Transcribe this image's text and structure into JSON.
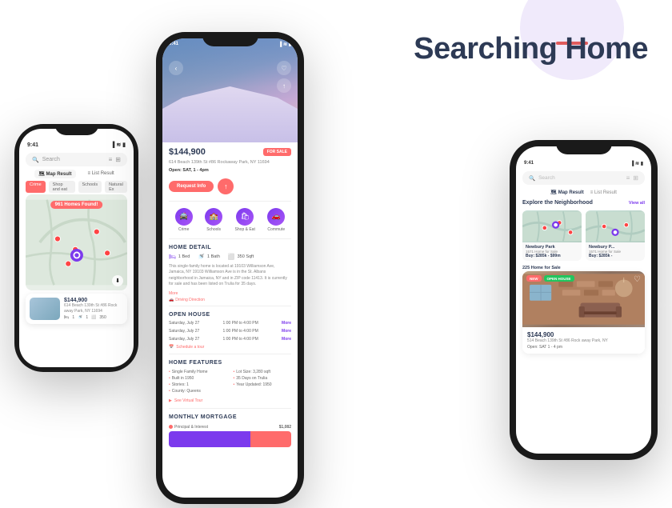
{
  "page": {
    "title": "Searching Home",
    "bg_circle_color": "#6c3fc5",
    "accent_color": "#ff6b6b",
    "brand_purple": "#7c3aed"
  },
  "phone_left": {
    "status": {
      "time": "9:41",
      "signal": "●●●",
      "wifi": "WiFi",
      "battery": "🔋"
    },
    "search_placeholder": "Search",
    "tabs": [
      {
        "label": "Map Result",
        "active": true
      },
      {
        "label": "List Result",
        "active": false
      }
    ],
    "filter_chips": [
      "Crime",
      "Shop and eat",
      "Schools",
      "Natural Exp"
    ],
    "homes_count": "961 Homes Found!",
    "card": {
      "price": "$144,900",
      "address": "614 Beach 139th St #86 Rock away Park, NY 11694",
      "beds": "1",
      "baths": "1",
      "sqft": "350"
    }
  },
  "phone_mid": {
    "status": {
      "time": "9:41"
    },
    "price": "$144,900",
    "sale_badge": "FOR SALE",
    "address": "614 Beach 139th St #86 Rockaway Park, NY 11694",
    "open_hours": "Open: SAT, 1 - 4pm",
    "request_btn": "Request Info",
    "categories": [
      {
        "label": "Crime",
        "icon": "🚔"
      },
      {
        "label": "Schools",
        "icon": "🏫"
      },
      {
        "label": "Shop & Eat",
        "icon": "🛍"
      },
      {
        "label": "Commute",
        "icon": "🚗"
      }
    ],
    "home_detail": {
      "title": "HOME DETAIL",
      "bed": "1 Bed",
      "bath": "1 Bath",
      "sqft": "350 Sqft",
      "description": "This single-family home is located at 19103 Williamson Ave, Jamaica, NY 19103 Williamson Ave is in the St. Albans neighborhood in Jamaica, NY and in ZIP code 11413. It is currently for sale and has been listed on Trulia for 35 days.",
      "more": "More",
      "driving_direction": "Driving Direction"
    },
    "open_house": {
      "title": "OPEN HOUSE",
      "dates": [
        {
          "date": "Saturday, July 27",
          "time": "1:00 PM to 4:00 PM"
        },
        {
          "date": "Saturday, July 27",
          "time": "1:00 PM to 4:00 PM"
        },
        {
          "date": "Saturday, July 27",
          "time": "1:00 PM to 4:00 PM"
        }
      ],
      "more": "More",
      "schedule": "Schedule a tour"
    },
    "home_features": {
      "title": "HOME FEATURES",
      "col1": [
        "Single Family Home",
        "Built in 1950",
        "Stories: 1",
        "County: Queens"
      ],
      "col2": [
        "Lot Size: 3,280 sqft",
        "35 Days on Trulia",
        "Year Updated: 1950"
      ],
      "virtual_tour": "See Virtual Tour"
    },
    "monthly_mortgage": {
      "title": "MONTHLY MORTGAGE",
      "item": "Principal & Interest",
      "amount": "$1,082"
    }
  },
  "phone_right": {
    "status": {
      "time": "9:41"
    },
    "search_placeholder": "Search",
    "tabs": [
      {
        "label": "Map Result",
        "active": true
      },
      {
        "label": "List Result",
        "active": false
      }
    ],
    "explore": {
      "title": "Explore the Neighborhood",
      "view_all": "View all",
      "neighborhoods": [
        {
          "name": "Newbury Park",
          "homes": "1571",
          "type": "Home for Sale",
          "price": "Buy: $285k - $99m"
        },
        {
          "name": "Newbury P...",
          "homes": "1571",
          "type": "Home for Sale",
          "price": "Buy: $285k -"
        }
      ]
    },
    "homes_for_sale": "225 Home for Sale",
    "featured_home": {
      "badges": [
        "NEW",
        "OPEN HOUSE"
      ],
      "price": "$144,900",
      "address": "514 Beach 139th St #86 Rock away Park, NY",
      "open_hours": "Open: SAT 1 - 4 pm"
    }
  }
}
